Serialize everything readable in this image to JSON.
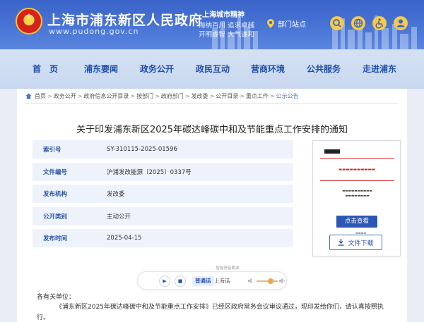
{
  "header": {
    "site_title": "上海市浦东新区人民政府",
    "site_url": "www.pudong.gov.cn",
    "spirit": {
      "title": "上海城市精神",
      "line1": "海纳百川  追求卓越",
      "line2": "开明睿智  大气谦和"
    },
    "dept_link": "部门站点",
    "icons": [
      "search-icon",
      "globe-icon",
      "accessibility-icon",
      "user-icon"
    ]
  },
  "nav": {
    "items": [
      "首　页",
      "浦东要闻",
      "政务公开",
      "政民互动",
      "营商环境",
      "公共服务",
      "走进浦东"
    ]
  },
  "breadcrumb": [
    "首页",
    "政务公开",
    "政府信息公开目录",
    "按部门",
    "政府部门",
    "发改委",
    "公开目录",
    "重点工作",
    "公示公告"
  ],
  "document": {
    "title": "关于印发浦东新区2025年碳达峰碳中和及节能重点工作安排的通知",
    "meta": [
      {
        "label": "索引号",
        "value": "SY-310115-2025-01596"
      },
      {
        "label": "文件编号",
        "value": "沪浦发改能源〔2025〕0337号"
      },
      {
        "label": "发布机构",
        "value": "发改委"
      },
      {
        "label": "公开类别",
        "value": "主动公开"
      },
      {
        "label": "发布时间",
        "value": "2025-04-15"
      }
    ],
    "view_button": "点击查看",
    "download_button": "文件下载"
  },
  "player": {
    "hint": "智能语音朗读",
    "mandarin": "普通话",
    "shanghainese": "上海话"
  },
  "body": {
    "greeting": "各有关单位：",
    "paragraph": "《浦东新区2025年碳达峰碳中和及节能重点工作安排》已经区政府常务会议审议通过，现印发给你们，请认真按照执行。"
  },
  "colors": {
    "header_blue": "#3a64c9",
    "nav_text": "#1e4fb0",
    "meta_label": "#2a54a8",
    "button_blue": "#2c57b4"
  }
}
